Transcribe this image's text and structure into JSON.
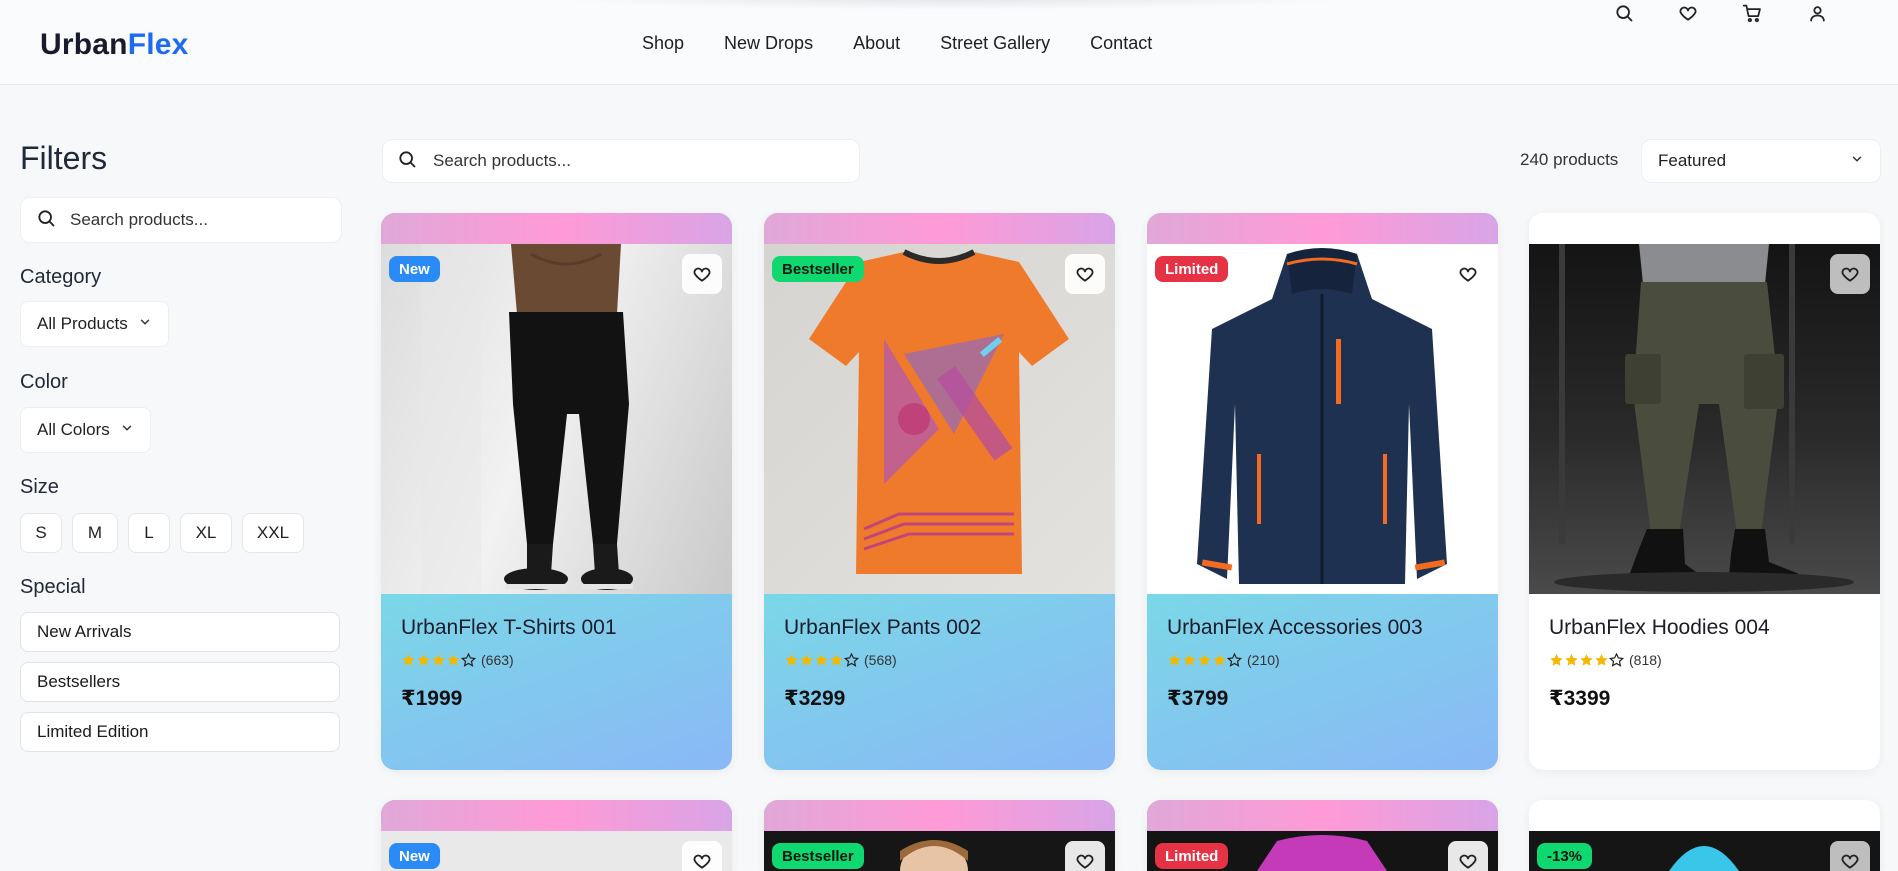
{
  "brand": {
    "part1": "Urban",
    "part2": "Flex"
  },
  "nav": [
    "Shop",
    "New Drops",
    "About",
    "Street Gallery",
    "Contact"
  ],
  "sidebar": {
    "title": "Filters",
    "search_placeholder": "Search products...",
    "category_label": "Category",
    "category_value": "All Products",
    "color_label": "Color",
    "color_value": "All Colors",
    "size_label": "Size",
    "sizes": [
      "S",
      "M",
      "L",
      "XL",
      "XXL"
    ],
    "special_label": "Special",
    "special": [
      "New Arrivals",
      "Bestsellers",
      "Limited Edition"
    ]
  },
  "toolbar": {
    "search_placeholder": "Search products...",
    "count": "240 products",
    "sort_value": "Featured"
  },
  "products": [
    {
      "badge": "New",
      "name": "UrbanFlex T-Shirts 001",
      "rating_count": "(663)",
      "price": "₹1999",
      "stars": 4
    },
    {
      "badge": "Bestseller",
      "name": "UrbanFlex Pants 002",
      "rating_count": "(568)",
      "price": "₹3299",
      "stars": 4
    },
    {
      "badge": "Limited",
      "name": "UrbanFlex Accessories 003",
      "rating_count": "(210)",
      "price": "₹3799",
      "stars": 4
    },
    {
      "badge": "",
      "name": "UrbanFlex Hoodies 004",
      "rating_count": "(818)",
      "price": "₹3399",
      "stars": 4
    },
    {
      "badge": "New"
    },
    {
      "badge": "Bestseller"
    },
    {
      "badge": "Limited"
    },
    {
      "badge": "-13%"
    }
  ],
  "colors": {
    "accent": "#1e6bf0",
    "new": "#2a8af6",
    "bestseller": "#10d870",
    "limited": "#e53245",
    "star": "#f5b800"
  }
}
